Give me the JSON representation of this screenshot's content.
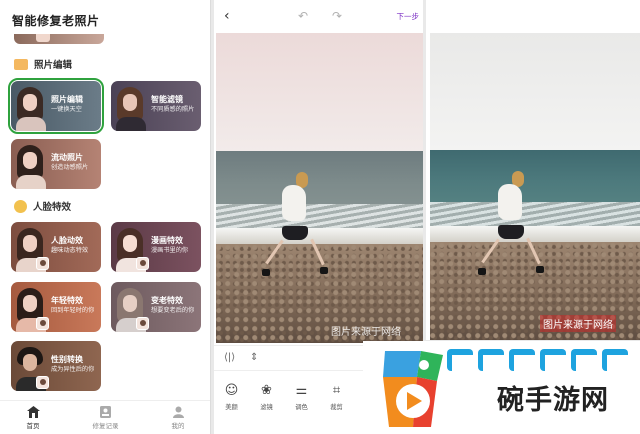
{
  "app": {
    "title": "智能修复老照片"
  },
  "sections": {
    "photo_edit": "照片编辑",
    "face_effects": "人脸特效"
  },
  "cards": {
    "photo_edit": {
      "title": "照片编辑",
      "sub": "一键换天空"
    },
    "smart_filter": {
      "title": "智能滤镜",
      "sub": "不同质感的照片"
    },
    "live_photo": {
      "title": "流动照片",
      "sub": "创造动感照片"
    },
    "face_anim": {
      "title": "人脸动效",
      "sub": "趣味动态特效"
    },
    "comic": {
      "title": "漫画特效",
      "sub": "漫画书里的你"
    },
    "younger": {
      "title": "年轻特效",
      "sub": "回到年轻时的你"
    },
    "older": {
      "title": "变老特效",
      "sub": "想要变老后的你"
    },
    "gender": {
      "title": "性别转换",
      "sub": "成为异性后的你"
    }
  },
  "tabbar": [
    {
      "label": "首页",
      "icon": "home-icon"
    },
    {
      "label": "修复记录",
      "icon": "record-icon"
    },
    {
      "label": "我的",
      "icon": "user-icon"
    }
  ],
  "editor": {
    "back_icon": "‹",
    "undo_icon": "↶",
    "redo_icon": "↷",
    "next_label": "下一步",
    "tools": [
      {
        "label": "美颜",
        "icon": "face-beauty-icon",
        "glyph": "☺"
      },
      {
        "label": "滤镜",
        "icon": "filter-icon",
        "glyph": "❀"
      },
      {
        "label": "调色",
        "icon": "adjust-icon",
        "glyph": "⚌"
      },
      {
        "label": "裁剪",
        "icon": "crop-icon",
        "glyph": "⌗"
      }
    ]
  },
  "watermarks": {
    "middle": "图片来源于网络",
    "right": "图片来源于网络"
  },
  "brand": {
    "name": "碗手游网"
  },
  "colors": {
    "accent_purple": "#7b2ec4",
    "selected_green": "#2fa23e"
  }
}
